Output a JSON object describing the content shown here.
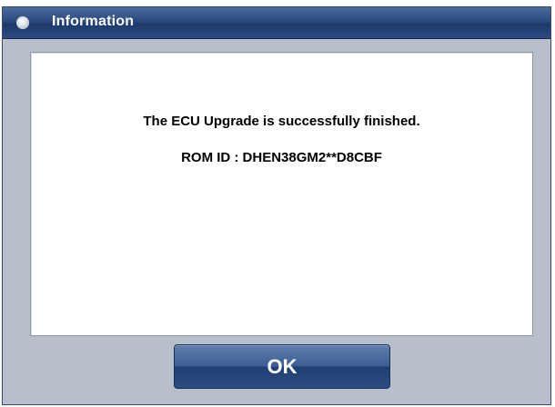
{
  "dialog": {
    "title": "Information",
    "title_icon": "window-circle-icon",
    "message": "The ECU Upgrade is successfully finished.",
    "rom_id": "ROM ID : DHEN38GM2**D8CBF",
    "ok_label": "OK"
  },
  "colors": {
    "titlebar": "#2b4a7e",
    "window_frame": "#b7bfcb",
    "content_bg": "#ffffff",
    "button": "#2f5186"
  }
}
